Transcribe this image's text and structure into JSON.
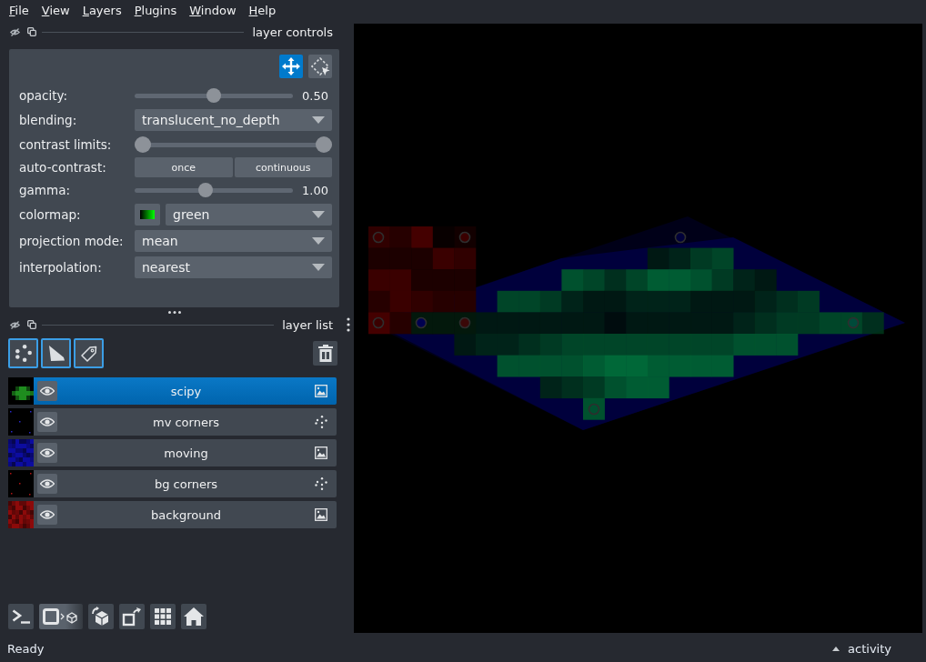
{
  "menu_bar": [
    "File",
    "View",
    "Layers",
    "Plugins",
    "Window",
    "Help"
  ],
  "layer_controls": {
    "title": "layer controls",
    "mode_buttons": [
      {
        "kind": "pan_zoom",
        "selected": true
      },
      {
        "kind": "transform",
        "selected": false
      }
    ],
    "rows": [
      {
        "kind": "slider",
        "label": "opacity:",
        "level": 0.5,
        "reading": "0.50"
      },
      {
        "kind": "dropdown",
        "label": "blending:",
        "value": "translucent_no_depth"
      },
      {
        "kind": "range",
        "label": "contrast limits:",
        "handles": [
          {
            "level": 0
          },
          {
            "level": 1
          }
        ]
      },
      {
        "kind": "buttons",
        "label": "auto-contrast:",
        "buttons": [
          "once",
          "continuous"
        ]
      },
      {
        "kind": "slider",
        "label": "gamma:",
        "level": 0.44,
        "reading": "1.00"
      },
      {
        "kind": "colormap",
        "label": "colormap:",
        "value": "green"
      },
      {
        "kind": "dropdown",
        "label": "projection mode:",
        "value": "mean"
      },
      {
        "kind": "dropdown",
        "label": "interpolation:",
        "value": "nearest"
      }
    ]
  },
  "layer_list": {
    "title": "layer list",
    "layers": [
      {
        "name": "scipy",
        "kind": "image",
        "selected": true,
        "visible": true,
        "color": "#1e8c1e"
      },
      {
        "name": "mv corners",
        "kind": "points",
        "selected": false,
        "visible": true,
        "color": "#2828c8"
      },
      {
        "name": "moving",
        "kind": "image",
        "selected": false,
        "visible": true,
        "color": "#0c0ca0"
      },
      {
        "name": "bg corners",
        "kind": "points",
        "selected": false,
        "visible": true,
        "color": "#b01414"
      },
      {
        "name": "background",
        "kind": "image",
        "selected": false,
        "visible": true,
        "color": "#8c0a0a"
      }
    ]
  },
  "status_bar": {
    "message": "Ready",
    "activity": "activity"
  }
}
